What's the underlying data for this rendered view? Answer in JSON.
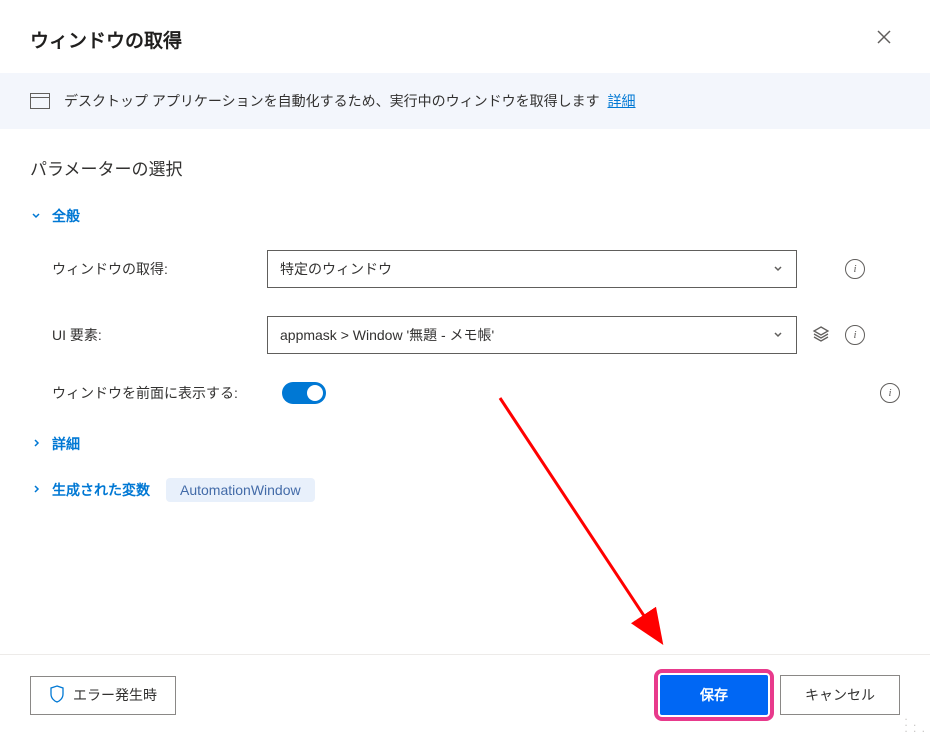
{
  "header": {
    "title": "ウィンドウの取得"
  },
  "banner": {
    "text": "デスクトップ アプリケーションを自動化するため、実行中のウィンドウを取得します",
    "link": "詳細"
  },
  "sections": {
    "parameter_title": "パラメーターの選択",
    "general": {
      "label": "全般",
      "expanded": true
    },
    "advanced": {
      "label": "詳細",
      "expanded": false
    },
    "variables": {
      "label": "生成された変数",
      "expanded": false,
      "badge": "AutomationWindow"
    }
  },
  "fields": {
    "get_window": {
      "label": "ウィンドウの取得:",
      "value": "特定のウィンドウ"
    },
    "ui_element": {
      "label": "UI 要素:",
      "value": "appmask > Window '無題 - メモ帳'"
    },
    "bring_to_front": {
      "label": "ウィンドウを前面に表示する:",
      "checked": true
    }
  },
  "footer": {
    "error_button": "エラー発生時",
    "save_button": "保存",
    "cancel_button": "キャンセル"
  }
}
